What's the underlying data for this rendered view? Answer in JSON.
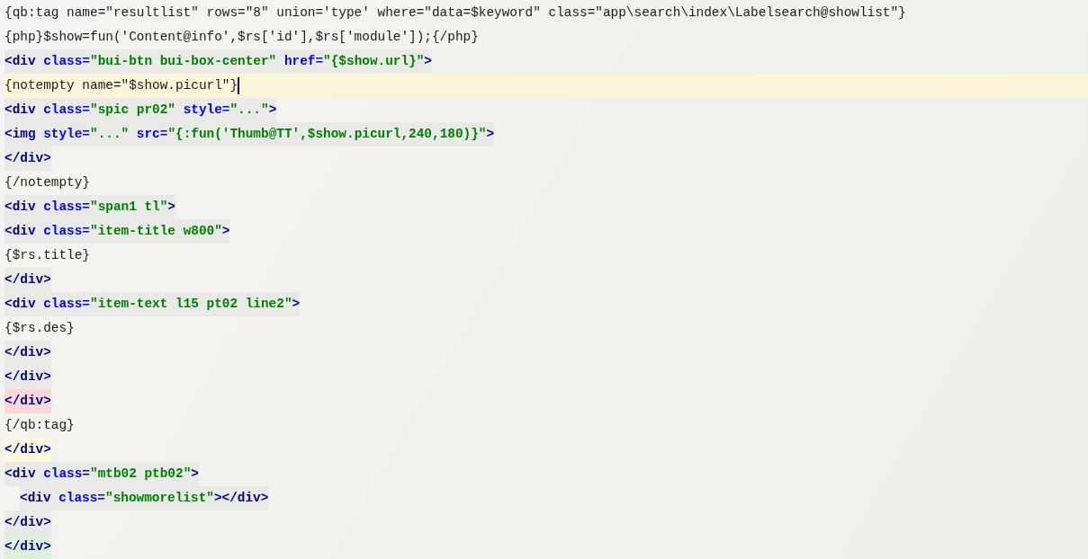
{
  "editor": {
    "lines": [
      {
        "kind": "template",
        "current": false,
        "tokens": [
          {
            "kind": "plain",
            "text": "{qb:tag name=\"resultlist\" rows=\"8\" union='type' where=\"data=$keyword\" class=\"app\\search\\index\\Labelsearch@showlist\"}"
          }
        ]
      },
      {
        "kind": "template",
        "current": false,
        "tokens": [
          {
            "kind": "plain",
            "text": "{php}$show=fun('Content@info',$rs['id'],$rs['module']);{/php}"
          }
        ]
      },
      {
        "kind": "html",
        "current": false,
        "tokens": [
          {
            "kind": "tag",
            "text": "<div"
          },
          {
            "kind": "attr",
            "text": " class="
          },
          {
            "kind": "value",
            "text": "\"bui-btn bui-box-center\""
          },
          {
            "kind": "attr",
            "text": " href="
          },
          {
            "kind": "value",
            "text": "\"{$show.url}\""
          },
          {
            "kind": "tag",
            "text": ">"
          }
        ]
      },
      {
        "kind": "template",
        "current": true,
        "tokens": [
          {
            "kind": "plain",
            "text": "{notempty name=\"$show.picurl\"}"
          }
        ]
      },
      {
        "kind": "html",
        "current": false,
        "tokens": [
          {
            "kind": "tag",
            "text": "<div"
          },
          {
            "kind": "attr",
            "text": " class="
          },
          {
            "kind": "value",
            "text": "\"spic pr02\""
          },
          {
            "kind": "attr",
            "text": " style="
          },
          {
            "kind": "value",
            "text": "\"...\""
          },
          {
            "kind": "tag",
            "text": ">"
          }
        ]
      },
      {
        "kind": "html",
        "current": false,
        "tokens": [
          {
            "kind": "tag",
            "text": "<img"
          },
          {
            "kind": "attr",
            "text": " style="
          },
          {
            "kind": "value",
            "text": "\"...\""
          },
          {
            "kind": "attr",
            "text": " src="
          },
          {
            "kind": "value",
            "text": "\"{:fun('Thumb@TT',$show.picurl,240,180)}\""
          },
          {
            "kind": "tag",
            "text": ">"
          }
        ]
      },
      {
        "kind": "html",
        "current": false,
        "tokens": [
          {
            "kind": "tag",
            "text": "</div>"
          }
        ]
      },
      {
        "kind": "template",
        "current": false,
        "tokens": [
          {
            "kind": "plain",
            "text": "{/notempty}"
          }
        ]
      },
      {
        "kind": "html",
        "current": false,
        "tokens": [
          {
            "kind": "tag",
            "text": "<div"
          },
          {
            "kind": "attr",
            "text": " class="
          },
          {
            "kind": "value",
            "text": "\"span1 tl\""
          },
          {
            "kind": "tag",
            "text": ">"
          }
        ]
      },
      {
        "kind": "html",
        "current": false,
        "tokens": [
          {
            "kind": "tag",
            "text": "<div"
          },
          {
            "kind": "attr",
            "text": " class="
          },
          {
            "kind": "value",
            "text": "\"item-title w800\""
          },
          {
            "kind": "tag",
            "text": ">"
          }
        ]
      },
      {
        "kind": "template",
        "current": false,
        "tokens": [
          {
            "kind": "plain",
            "text": "{$rs.title}"
          }
        ]
      },
      {
        "kind": "html",
        "current": false,
        "tokens": [
          {
            "kind": "tag",
            "text": "</div>"
          }
        ]
      },
      {
        "kind": "html",
        "current": false,
        "tokens": [
          {
            "kind": "tag",
            "text": "<div"
          },
          {
            "kind": "attr",
            "text": " class="
          },
          {
            "kind": "value",
            "text": "\"item-text l15 pt02 line2\""
          },
          {
            "kind": "tag",
            "text": ">"
          }
        ]
      },
      {
        "kind": "template",
        "current": false,
        "tokens": [
          {
            "kind": "plain",
            "text": "{$rs.des}"
          }
        ]
      },
      {
        "kind": "html",
        "current": false,
        "tokens": [
          {
            "kind": "tag",
            "text": "</div>"
          }
        ]
      },
      {
        "kind": "html",
        "current": false,
        "tokens": [
          {
            "kind": "tag",
            "text": "</div>"
          }
        ]
      },
      {
        "kind": "html",
        "current": false,
        "color": "#f8d8d8",
        "tokens": [
          {
            "kind": "tag",
            "text": "</div>"
          }
        ]
      },
      {
        "kind": "template",
        "current": false,
        "tokens": [
          {
            "kind": "plain",
            "text": "{/qb:tag}"
          }
        ]
      },
      {
        "kind": "html",
        "current": false,
        "color": "#fbf6dc",
        "tokens": [
          {
            "kind": "tag",
            "text": "</div>"
          }
        ]
      },
      {
        "kind": "html",
        "current": false,
        "tokens": [
          {
            "kind": "tag",
            "text": "<div"
          },
          {
            "kind": "attr",
            "text": " class="
          },
          {
            "kind": "value",
            "text": "\"mtb02 ptb02\""
          },
          {
            "kind": "tag",
            "text": ">"
          }
        ]
      },
      {
        "kind": "html",
        "current": false,
        "indented": true,
        "tokens": [
          {
            "kind": "tag",
            "text": "<div"
          },
          {
            "kind": "attr",
            "text": " class="
          },
          {
            "kind": "value",
            "text": "\"showmorelist\""
          },
          {
            "kind": "tag",
            "text": "></div>"
          }
        ]
      },
      {
        "kind": "html",
        "current": false,
        "tokens": [
          {
            "kind": "tag",
            "text": "</div>"
          }
        ]
      },
      {
        "kind": "html",
        "current": false,
        "color": "#dcf0dc",
        "tokens": [
          {
            "kind": "tag",
            "text": "</div>"
          }
        ]
      }
    ]
  }
}
